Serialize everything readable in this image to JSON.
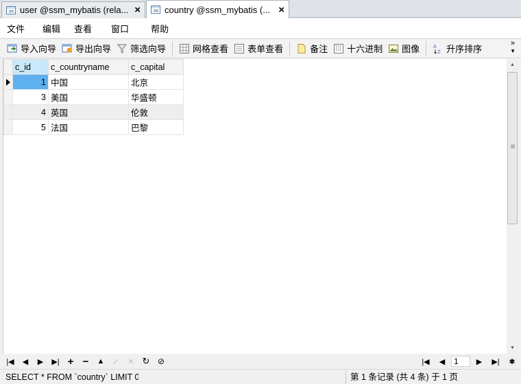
{
  "tabs": [
    {
      "label": "user @ssm_mybatis (rela...",
      "close": "×",
      "active": false
    },
    {
      "label": "country @ssm_mybatis (...",
      "close": "×",
      "active": true
    }
  ],
  "menu": [
    "文件",
    "编辑",
    "查看",
    "窗口",
    "帮助"
  ],
  "toolbar": {
    "import_wizard": "导入向导",
    "export_wizard": "导出向导",
    "filter_wizard": "筛选向导",
    "grid_view": "网格查看",
    "form_view": "表单查看",
    "memo": "备注",
    "hex": "十六进制",
    "image": "图像",
    "sort_asc": "升序排序",
    "more": "»"
  },
  "grid": {
    "columns": [
      "c_id",
      "c_countryname",
      "c_capital"
    ],
    "rows": [
      {
        "c_id": "1",
        "c_countryname": "中国",
        "c_capital": "北京"
      },
      {
        "c_id": "3",
        "c_countryname": "美国",
        "c_capital": "华盛顿"
      },
      {
        "c_id": "4",
        "c_countryname": "英国",
        "c_capital": "伦敦"
      },
      {
        "c_id": "5",
        "c_countryname": "法国",
        "c_capital": "巴黎"
      }
    ]
  },
  "nav": {
    "page": "1"
  },
  "status": {
    "sql": "SELECT * FROM `country` LIMIT 0,",
    "info": "第 1 条记录 (共 4 条) 于 1 页"
  },
  "colors": {
    "accent": "#5eb0ee",
    "header_selected": "#c9e8fb"
  }
}
